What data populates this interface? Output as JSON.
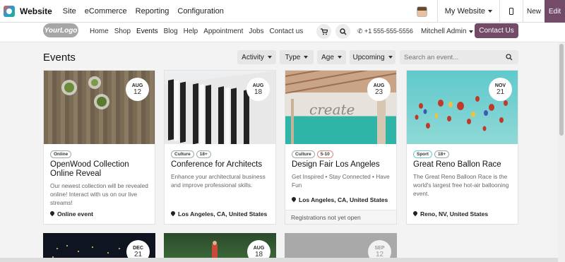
{
  "adminbar": {
    "title": "Website",
    "menu": [
      "Site",
      "eCommerce",
      "Reporting",
      "Configuration"
    ],
    "website_switcher": "My Website",
    "new_label": "New",
    "edit_label": "Edit"
  },
  "header": {
    "logo": "YourLogo",
    "nav": [
      "Home",
      "Shop",
      "Events",
      "Blog",
      "Help",
      "Appointment",
      "Jobs",
      "Contact us"
    ],
    "active_nav": "Events",
    "phone": "+1 555-555-5556",
    "user": "Mitchell Admin",
    "cta": "Contact Us"
  },
  "page": {
    "title": "Events",
    "filters": [
      "Activity",
      "Type",
      "Age",
      "Upcoming"
    ],
    "search_placeholder": "Search an event..."
  },
  "events": [
    {
      "month": "AUG",
      "day": "12",
      "tags": [
        "Online"
      ],
      "title": "OpenWood Collection Online Reveal",
      "desc": "Our newest collection will be revealed online! Interact with us on our live streams!",
      "location": "Online event"
    },
    {
      "month": "AUG",
      "day": "18",
      "tags": [
        "Culture",
        "18+"
      ],
      "title": "Conference for Architects",
      "desc": "Enhance your architectural business and improve professional skills.",
      "location": "Los Angeles, CA, United States"
    },
    {
      "month": "AUG",
      "day": "23",
      "tags": [
        "Culture",
        "5-10"
      ],
      "title": "Design Fair Los Angeles",
      "desc": "Get Inspired • Stay Connected • Have Fun",
      "location": "Los Angeles, CA, United States",
      "footer": "Registrations not yet open"
    },
    {
      "month": "NOV",
      "day": "21",
      "tags": [
        "Sport",
        "18+"
      ],
      "title": "Great Reno Ballon Race",
      "desc": "The Great Reno Balloon Race is the world's largest free hot-air ballooning event.",
      "location": "Reno, NV, United States"
    }
  ],
  "more_events": [
    {
      "month": "DEC",
      "day": "21"
    },
    {
      "month": "AUG",
      "day": "18"
    },
    {
      "month": "SEP",
      "day": "12"
    }
  ]
}
